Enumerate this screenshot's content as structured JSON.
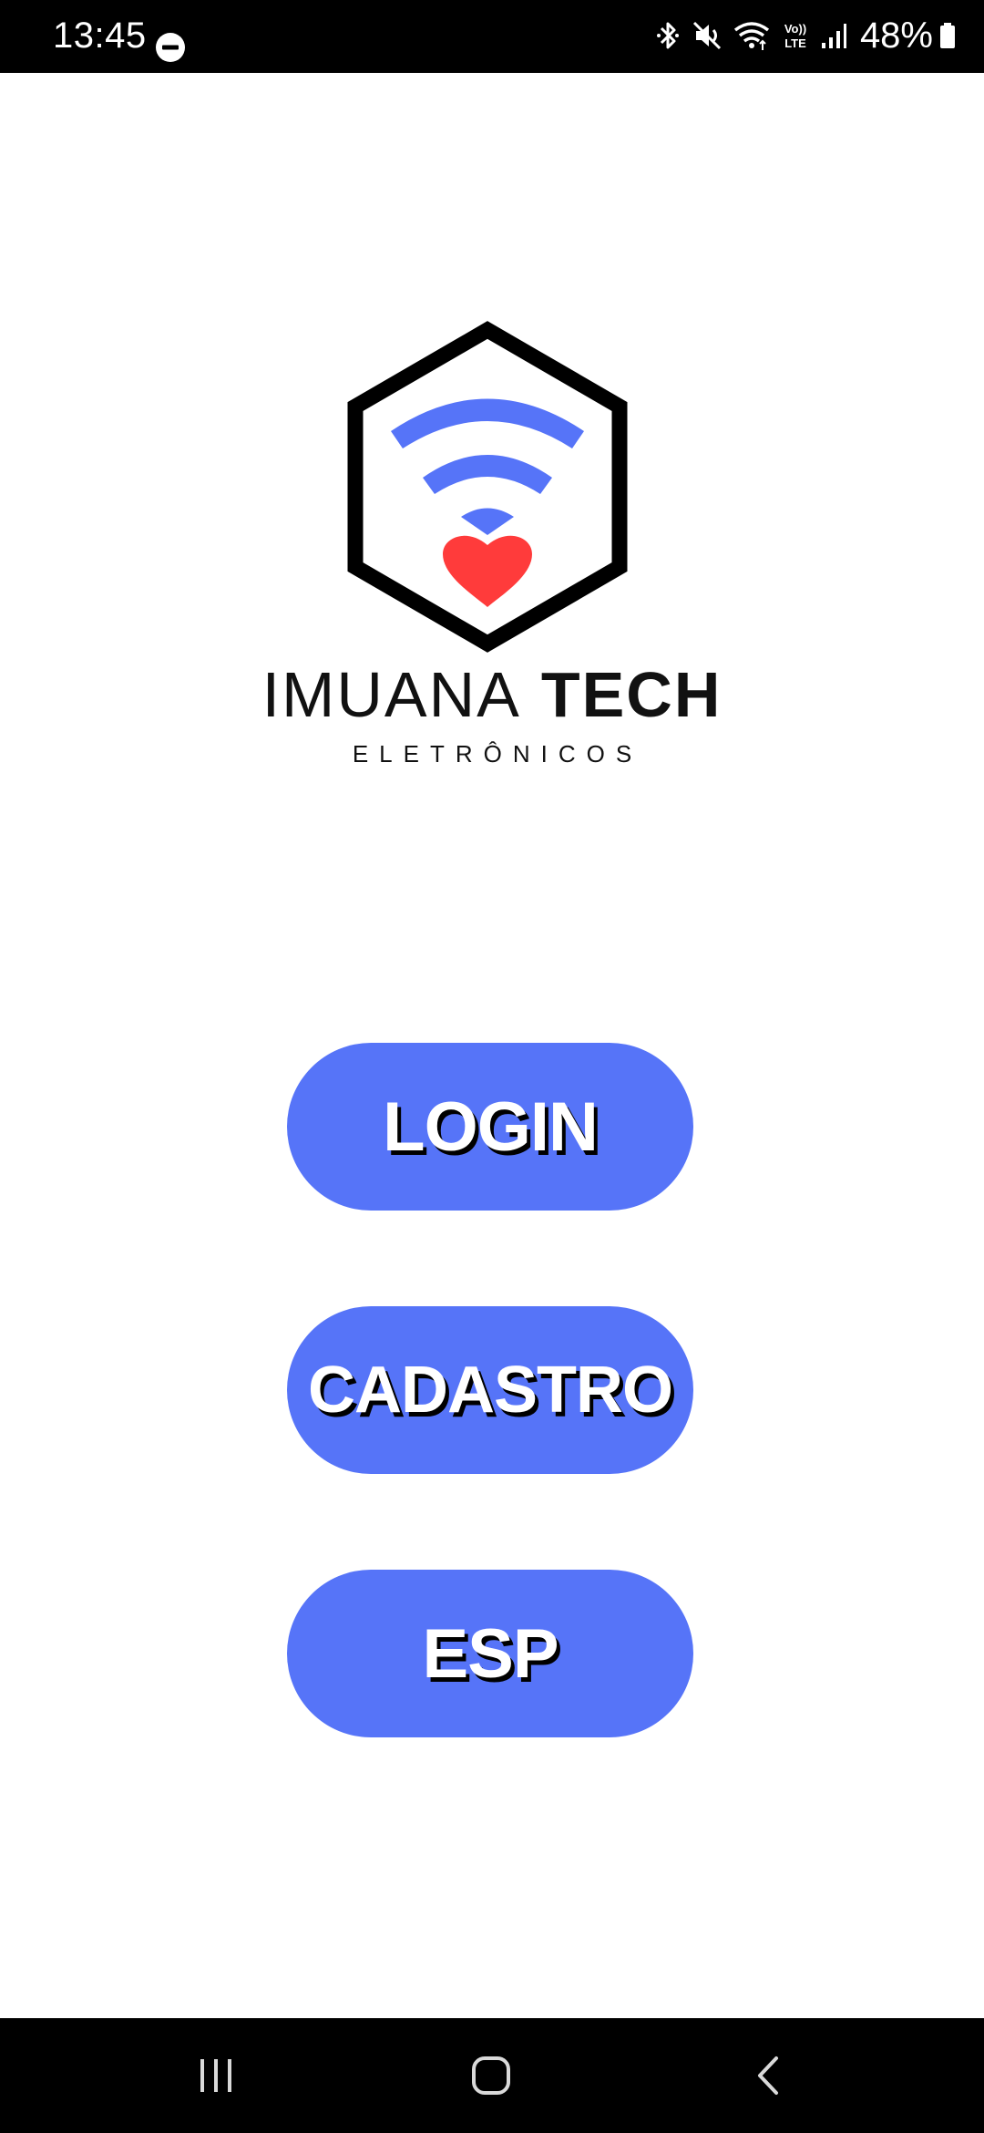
{
  "status_bar": {
    "time": "13:45",
    "battery_percent": "48%",
    "icons": [
      "do-not-disturb-icon",
      "bluetooth-icon",
      "mute-icon",
      "wifi-icon",
      "volte-icon",
      "signal-icon",
      "battery-icon"
    ],
    "volte_label_top": "Vo))",
    "volte_label_bottom": "LTE"
  },
  "logo": {
    "title_light": "IMUANA",
    "title_bold": "TECH",
    "subtitle": "ELETRÔNICOS",
    "colors": {
      "hexagon": "#000000",
      "wifi": "#5674f8",
      "heart": "#ff3b3b"
    }
  },
  "menu": {
    "login_label": "LOGIN",
    "cadastro_label": "CADASTRO",
    "esp_label": "ESP",
    "button_color": "#5674f8"
  },
  "nav_bar": {
    "icons": [
      "recents-icon",
      "home-icon",
      "back-icon"
    ]
  }
}
